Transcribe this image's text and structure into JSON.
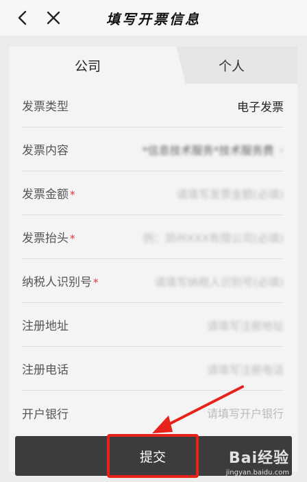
{
  "header": {
    "title": "填写开票信息"
  },
  "tabs": [
    {
      "label": "公司",
      "active": true
    },
    {
      "label": "个人",
      "active": false
    }
  ],
  "form": {
    "fields": [
      {
        "label": "发票类型",
        "required": false,
        "value": "电子发票"
      },
      {
        "label": "发票内容",
        "required": false,
        "value": "*信息技术服务*技术服务费"
      },
      {
        "label": "发票金额",
        "required": true,
        "placeholder": "请填写发票金额(必填)"
      },
      {
        "label": "发票抬头",
        "required": true,
        "placeholder": "例：郑州XXX有限公司(必填)"
      },
      {
        "label": "纳税人识别号",
        "required": true,
        "placeholder": "请填写纳税人识别号(必填)"
      },
      {
        "label": "注册地址",
        "required": false,
        "placeholder": "请填写注册地址"
      },
      {
        "label": "注册电话",
        "required": false,
        "placeholder": "请填写注册电话"
      },
      {
        "label": "开户银行",
        "required": false,
        "placeholder": "请填写开户银行"
      }
    ],
    "required_mark": "*"
  },
  "submit": {
    "label": "提交"
  },
  "watermark": {
    "main": "Bai经验",
    "sub": "jingyan.baidu.com"
  },
  "colors": {
    "accent_red": "#e8221b",
    "bar": "#3c3c3c",
    "required": "#e0362c"
  }
}
